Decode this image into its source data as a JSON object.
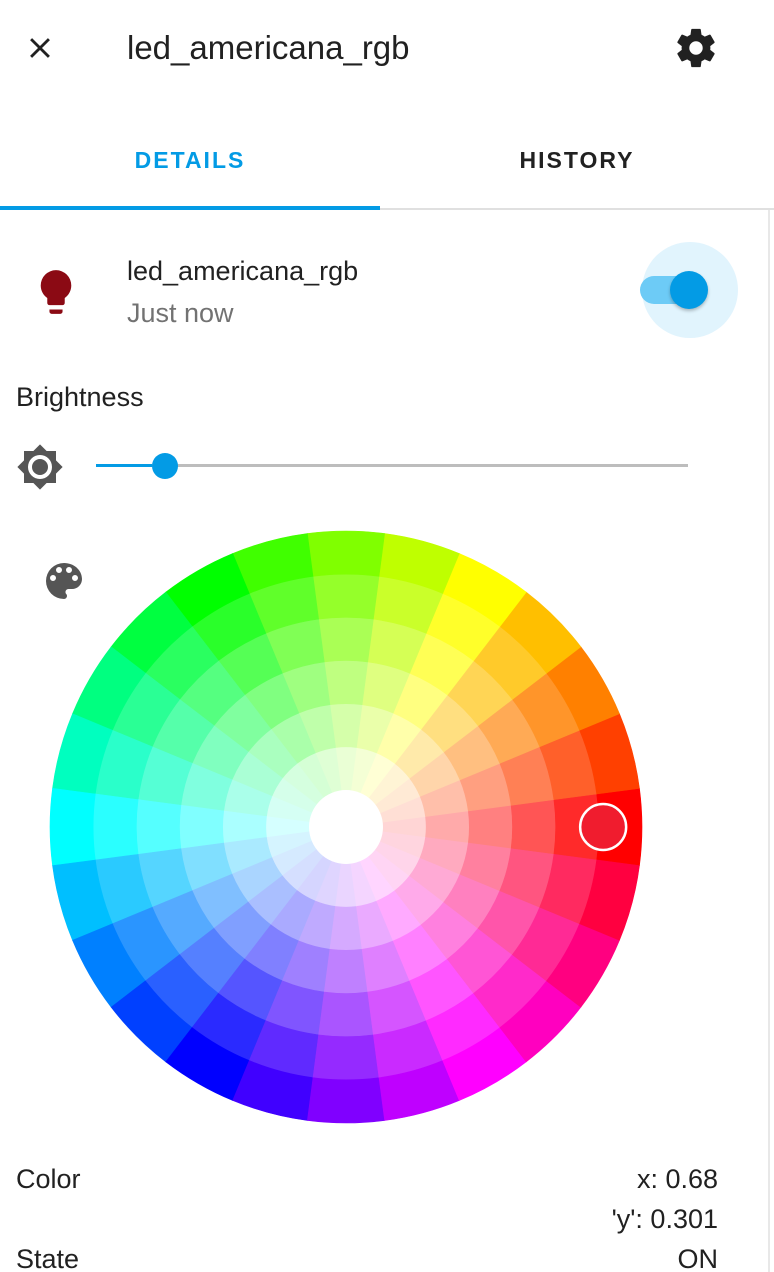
{
  "header": {
    "title": "led_americana_rgb",
    "close_icon": "close-icon",
    "settings_icon": "gear-icon"
  },
  "tabs": [
    {
      "label": "DETAILS",
      "active": true
    },
    {
      "label": "HISTORY",
      "active": false
    }
  ],
  "entity": {
    "name": "led_americana_rgb",
    "last_changed": "Just now",
    "icon": "lightbulb-icon",
    "icon_color": "#8b0a14",
    "toggle_on": true
  },
  "brightness": {
    "label": "Brightness",
    "icon": "brightness-icon",
    "value_fraction": 0.06
  },
  "color_picker": {
    "icon": "palette-icon",
    "selected_color": "#f01c2e",
    "selected_hue_deg": 0,
    "selected_saturation": 0.85
  },
  "attributes": [
    {
      "label": "Color",
      "value_lines": [
        "x: 0.68",
        "'y': 0.301"
      ]
    },
    {
      "label": "State",
      "value_lines": [
        "ON"
      ]
    }
  ],
  "colors": {
    "accent": "#039be5",
    "toggle_track": "#6dcbf6",
    "text_primary": "#212121",
    "text_secondary": "#727272"
  }
}
